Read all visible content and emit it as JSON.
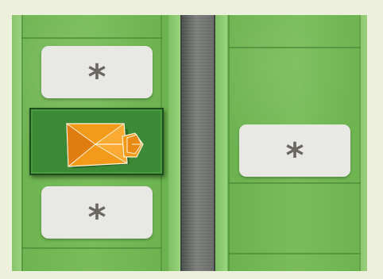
{
  "board": {
    "empty_slot_symbol": "*",
    "colors": {
      "grass": "#6fb552",
      "road": "#6a6d69",
      "slot": "#e8e8e4",
      "selected_lot": "#3d8a36",
      "house_roof": "#f39a1a"
    }
  },
  "slots": [
    {
      "id": "slot-left-top",
      "label": "*"
    },
    {
      "id": "slot-left-bottom",
      "label": "*"
    },
    {
      "id": "slot-right-middle",
      "label": "*"
    }
  ],
  "house": {
    "icon": "house-roof-icon"
  }
}
